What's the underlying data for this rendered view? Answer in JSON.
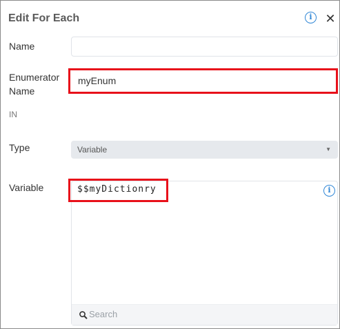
{
  "dialog": {
    "title": "Edit For Each"
  },
  "fields": {
    "name": {
      "label": "Name",
      "value": ""
    },
    "enumerator": {
      "label_line1": "Enumerator",
      "label_line2": "Name",
      "value": "myEnum"
    },
    "section_in": "IN",
    "type": {
      "label": "Type",
      "selected": "Variable"
    },
    "variable": {
      "label": "Variable",
      "value": "$$myDictionry",
      "search_placeholder": "Search"
    }
  },
  "icons": {
    "info": "info-icon",
    "close": "close-icon",
    "search": "search-icon",
    "caret": "caret-down-icon"
  },
  "colors": {
    "info": "#2f86d6",
    "highlight": "#e8101a",
    "select_bg": "#e6e9ed"
  }
}
